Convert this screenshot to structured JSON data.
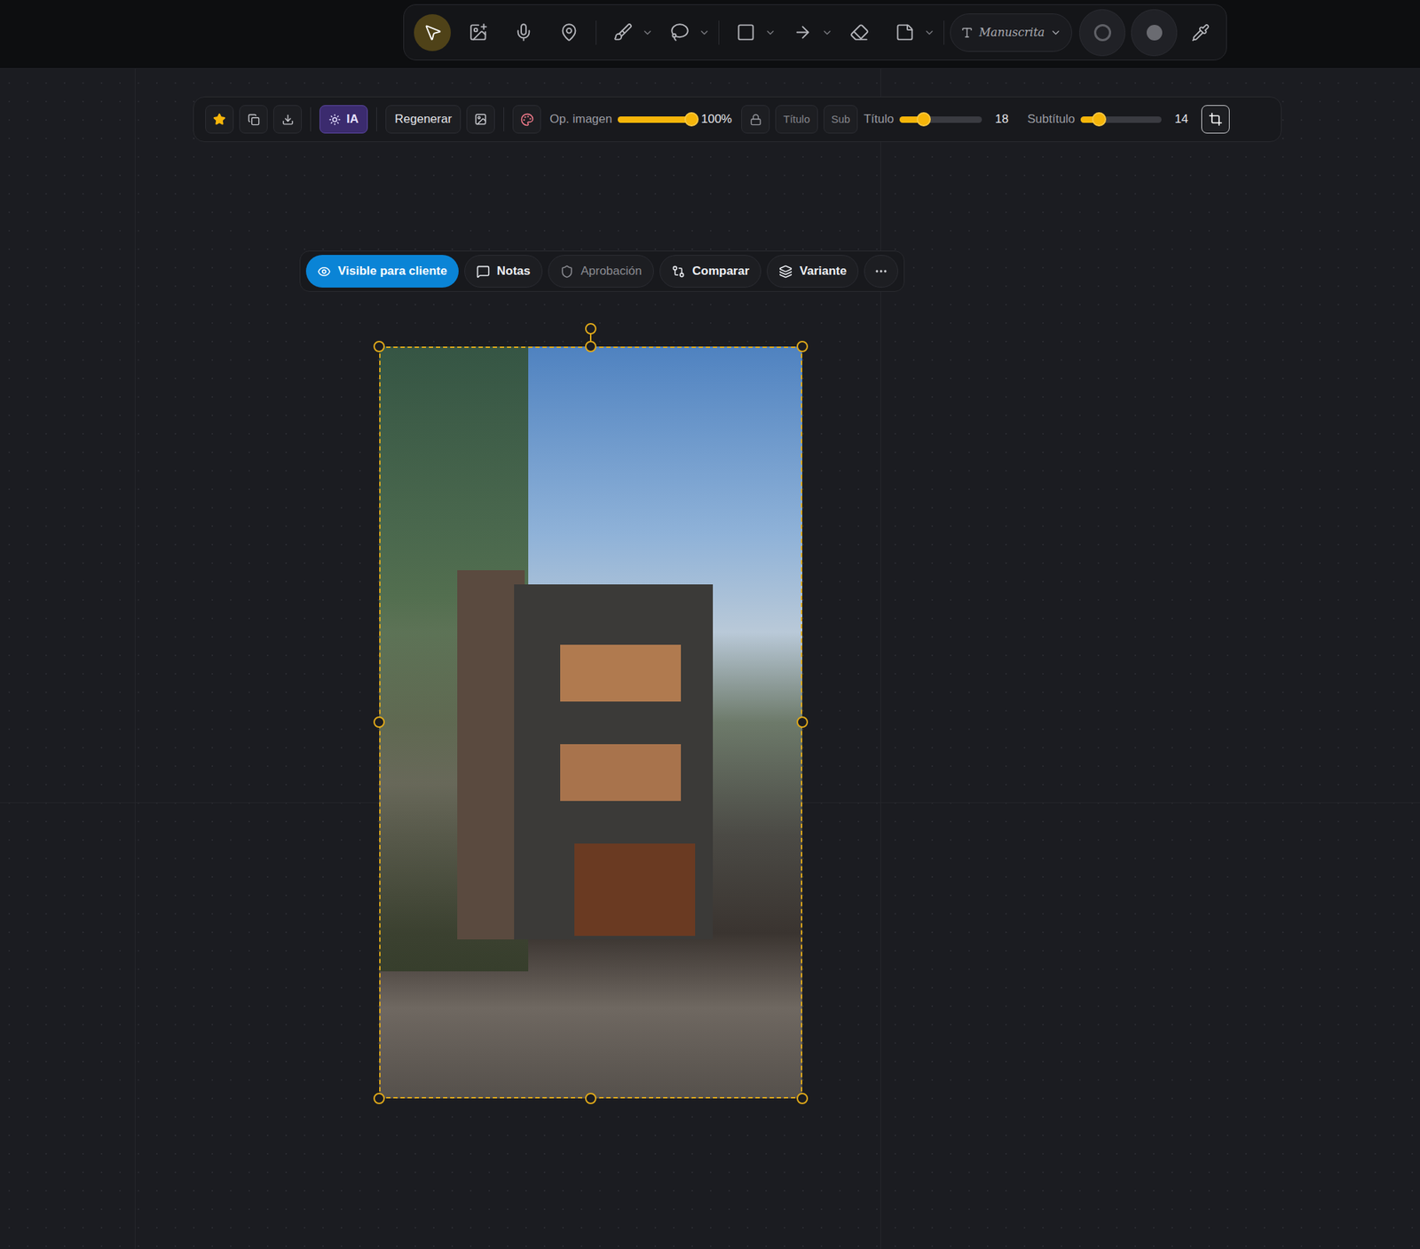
{
  "toolbar": {
    "groups": [
      [
        {
          "kind": "select",
          "selected": true,
          "menu": false
        },
        {
          "kind": "image",
          "selected": false,
          "menu": false
        },
        {
          "kind": "mic",
          "selected": false,
          "menu": false
        },
        {
          "kind": "pin",
          "selected": false,
          "menu": false
        }
      ],
      [
        {
          "kind": "brush",
          "selected": false,
          "menu": true
        },
        {
          "kind": "lasso",
          "selected": false,
          "menu": true
        }
      ],
      [
        {
          "kind": "square",
          "selected": false,
          "menu": true
        },
        {
          "kind": "arrow",
          "selected": false,
          "menu": true
        },
        {
          "kind": "eraser",
          "selected": false,
          "menu": false
        },
        {
          "kind": "note",
          "selected": false,
          "menu": true
        }
      ]
    ],
    "font": "Manuscrita",
    "stroke_filled": false,
    "fill_filled": true
  },
  "image_toolbar": {
    "favorite": true,
    "ai": {
      "label": "IA",
      "selected": true
    },
    "regenerate": "Regenerar",
    "opacity": {
      "label": "Op. imagen",
      "level": 1,
      "reading": "100%"
    },
    "locked": false,
    "title_toggle": {
      "label": "Título",
      "selected": false
    },
    "sub_toggle": {
      "label": "Sub",
      "selected": false
    },
    "title_size": {
      "label": "Título",
      "level": 0.29,
      "reading": "18"
    },
    "subtitle_size": {
      "label": "Subtítulo",
      "level": 0.23,
      "reading": "14"
    },
    "crop": {
      "selected": true
    }
  },
  "chips": [
    {
      "label": "Visible para cliente",
      "kind": "eye",
      "selected": true,
      "disabled": false
    },
    {
      "label": "Notas",
      "kind": "notes",
      "selected": false,
      "disabled": false
    },
    {
      "label": "Aprobación",
      "kind": "approval",
      "selected": false,
      "disabled": true
    },
    {
      "label": "Comparar",
      "kind": "compare",
      "selected": false,
      "disabled": false
    },
    {
      "label": "Variante",
      "kind": "variant",
      "selected": false,
      "disabled": false
    }
  ],
  "image": {
    "selected": true
  }
}
